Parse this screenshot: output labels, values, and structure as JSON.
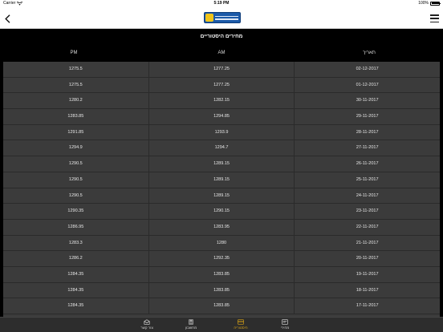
{
  "statusbar": {
    "carrier": "Carrier",
    "time": "5:19 PM",
    "battery": "100%"
  },
  "section": {
    "title": "מחירים היסטוריים"
  },
  "table": {
    "columns": [
      "PM",
      "AM",
      "תאריך"
    ],
    "rows": [
      [
        "1275.5",
        "1277.25",
        "02-12-2017"
      ],
      [
        "1275.5",
        "1277.25",
        "01-12-2017"
      ],
      [
        "1280.2",
        "1282.15",
        "30-11-2017"
      ],
      [
        "1283.85",
        "1294.85",
        "29-11-2017"
      ],
      [
        "1291.85",
        "1293.9",
        "28-11-2017"
      ],
      [
        "1294.9",
        "1294.7",
        "27-11-2017"
      ],
      [
        "1290.5",
        "1289.15",
        "26-11-2017"
      ],
      [
        "1290.5",
        "1289.15",
        "25-11-2017"
      ],
      [
        "1290.5",
        "1289.15",
        "24-11-2017"
      ],
      [
        "1290.35",
        "1290.15",
        "23-11-2017"
      ],
      [
        "1286.95",
        "1283.95",
        "22-11-2017"
      ],
      [
        "1283.3",
        "1280",
        "21-11-2017"
      ],
      [
        "1286.2",
        "1292.35",
        "20-11-2017"
      ],
      [
        "1284.35",
        "1283.85",
        "19-11-2017"
      ],
      [
        "1284.35",
        "1283.85",
        "18-11-2017"
      ],
      [
        "1284.35",
        "1283.85",
        "17-11-2017"
      ]
    ]
  },
  "tabs": [
    {
      "label": "צור קשר",
      "icon": "envelope-icon"
    },
    {
      "label": "מחשבון",
      "icon": "calculator-icon"
    },
    {
      "label": "היסטוריה",
      "icon": "history-icon"
    },
    {
      "label": "מחירי",
      "icon": "price-tag-icon"
    }
  ],
  "colors": {
    "accent": "#d4a017",
    "row_bg": "#3b3b3b",
    "header_bg": "#000000"
  }
}
